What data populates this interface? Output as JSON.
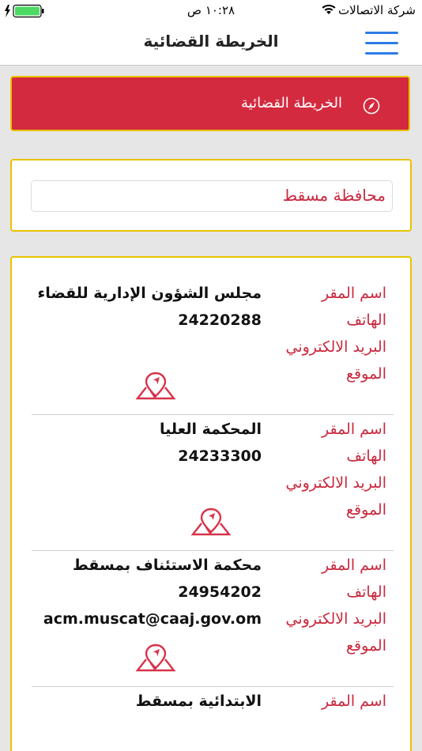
{
  "status_bar": {
    "carrier": "شركة الاتصالات",
    "time": "١٠:٢٨ ص"
  },
  "header": {
    "title": "الخريطة القضائية"
  },
  "banner": {
    "label": "الخريطة القضائية"
  },
  "governorate": {
    "selected": "محافظة مسقط"
  },
  "labels": {
    "name": "اسم المقر",
    "phone": "الهاتف",
    "email": "البريد الالكتروني",
    "location": "الموقع"
  },
  "entries": [
    {
      "name": "مجلس الشؤون الإدارية للقضاء",
      "phone": "24220288",
      "email": ""
    },
    {
      "name": "المحكمة العليا",
      "phone": "24233300",
      "email": ""
    },
    {
      "name": "محكمة الاستئناف بمسقط",
      "phone": "24954202",
      "email": "acm.muscat@caaj.gov.om"
    },
    {
      "name": "الابتدائية بمسقط"
    }
  ],
  "colors": {
    "accent_red": "#c8283e",
    "banner_red": "#d42a3f",
    "border_yellow": "#e8c300",
    "menu_blue": "#2c7be5"
  }
}
